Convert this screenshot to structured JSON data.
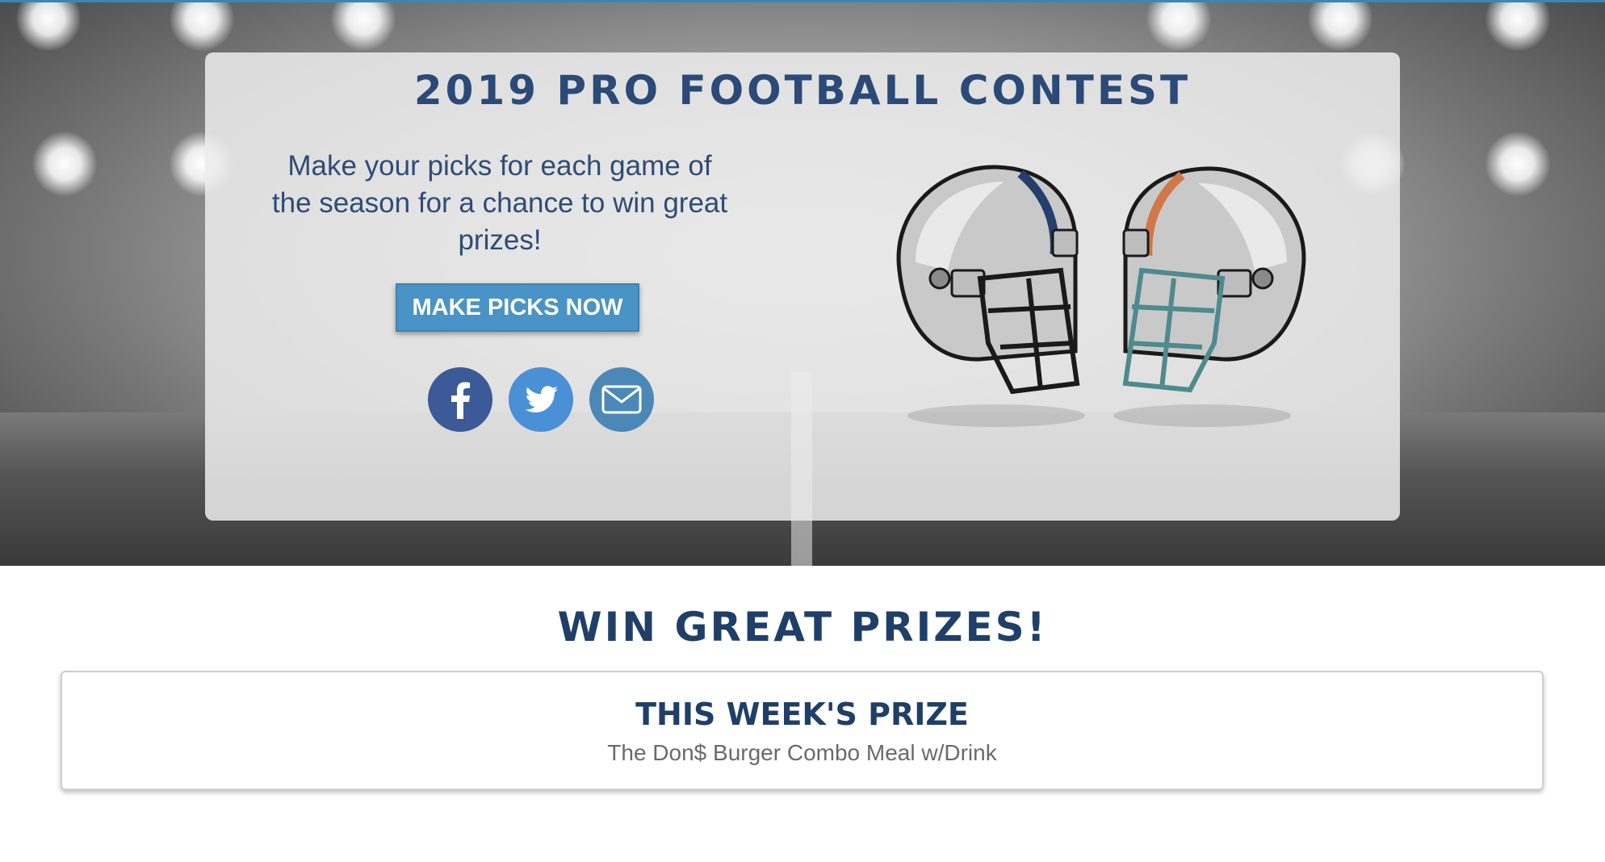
{
  "hero": {
    "title": "2019 PRO FOOTBALL CONTEST",
    "intro": "Make your picks for each game of the season for a chance to win great prizes!",
    "cta_label": "MAKE PICKS NOW",
    "social": [
      {
        "name": "facebook",
        "icon": "facebook-icon",
        "color": "#3d5a98"
      },
      {
        "name": "twitter",
        "icon": "twitter-icon",
        "color": "#4a90d6"
      },
      {
        "name": "email",
        "icon": "envelope-icon",
        "color": "#4b88b8"
      }
    ],
    "helmet_colors": {
      "left_stripe": "#243f6b",
      "right_stripe": "#d2774a",
      "right_facemask": "#4e8a8e"
    }
  },
  "prizes": {
    "section_title": "WIN GREAT PRIZES!",
    "weekly_heading": "THIS WEEK'S PRIZE",
    "weekly_prize": "The Don$ Burger Combo Meal w/Drink"
  },
  "colors": {
    "brand_navy": "#1f3f68",
    "button_blue": "#4a93c6",
    "top_accent": "#3a86b8"
  }
}
